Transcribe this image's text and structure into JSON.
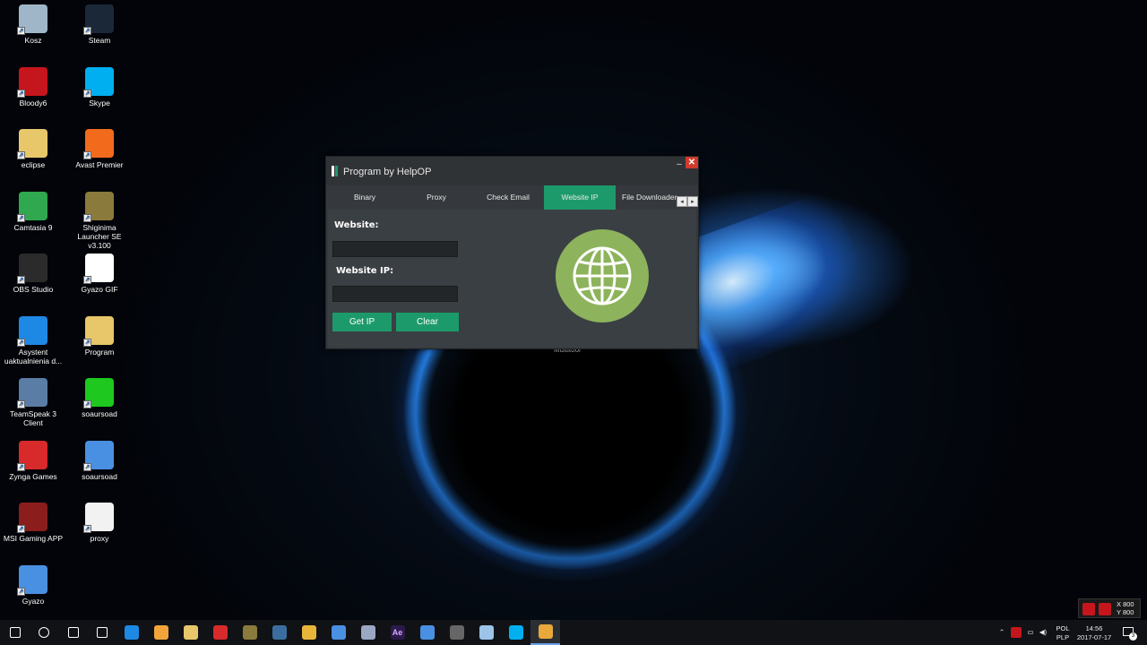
{
  "desktop": {
    "icons": [
      {
        "label": "Kosz",
        "icon": "recycle-bin-icon",
        "color": "#9fb6c9"
      },
      {
        "label": "Steam",
        "icon": "steam-icon",
        "color": "#1b2838"
      },
      {
        "label": "Bloody6",
        "icon": "bloody-hand-icon",
        "color": "#c4161c"
      },
      {
        "label": "Skype",
        "icon": "skype-icon",
        "color": "#00aff0"
      },
      {
        "label": "eclipse",
        "icon": "folder-icon",
        "color": "#e8c76a"
      },
      {
        "label": "Avast Premier",
        "icon": "avast-icon",
        "color": "#f26b1d"
      },
      {
        "label": "Camtasia 9",
        "icon": "camtasia-icon",
        "color": "#2fa84f"
      },
      {
        "label": "Shiginima Launcher SE v3.100",
        "icon": "minecraft-block-icon",
        "color": "#8a7a3c"
      },
      {
        "label": "OBS Studio",
        "icon": "obs-icon",
        "color": "#2b2b2b"
      },
      {
        "label": "Gyazo GIF",
        "icon": "gyazo-gif-icon",
        "color": "#ffffff"
      },
      {
        "label": "Asystent uaktualnienia d...",
        "icon": "windows-logo-icon",
        "color": "#1e88e5"
      },
      {
        "label": "Program",
        "icon": "folder-icon",
        "color": "#e8c76a"
      },
      {
        "label": "TeamSpeak 3 Client",
        "icon": "teamspeak-icon",
        "color": "#5a7da6"
      },
      {
        "label": "soaursoad",
        "icon": "green-image-icon",
        "color": "#1ec81e"
      },
      {
        "label": "Zynga Games",
        "icon": "zynga-icon",
        "color": "#d82a2a"
      },
      {
        "label": "soaursoad",
        "icon": "video-file-icon",
        "color": "#4a90e2"
      },
      {
        "label": "MSI Gaming APP",
        "icon": "msi-dragon-icon",
        "color": "#8b1d1d"
      },
      {
        "label": "proxy",
        "icon": "text-file-icon",
        "color": "#f2f2f2"
      },
      {
        "label": "Gyazo",
        "icon": "gyazo-icon",
        "color": "#4a90e2"
      }
    ],
    "behind_label": "Multitool"
  },
  "window": {
    "title": "Program by HelpOP",
    "minimize_glyph": "–",
    "close_glyph": "✕",
    "tabs": [
      "Binary",
      "Proxy",
      "Check Email",
      "Website IP",
      "File Downloader"
    ],
    "active_tab": "Website IP",
    "tab_scroll_left": "◂",
    "tab_scroll_right": "▸",
    "website_label": "Website:",
    "website_value": "",
    "website_ip_label": "Website IP:",
    "website_ip_value": "",
    "get_ip_button": "Get IP",
    "clear_button": "Clear",
    "accent": "#1d9a6b",
    "globe_color": "#8db35c"
  },
  "taskbar": {
    "items": [
      "start-windows-icon",
      "search-icon",
      "task-view-icon",
      "store-icon",
      "edge-icon",
      "video-player-icon",
      "file-explorer-icon",
      "zynga-icon",
      "minecraft-block-icon",
      "steam-icon",
      "chrome-icon",
      "gyazo-icon",
      "obs-pill-icon",
      "after-effects-icon",
      "gyazo-gif-icon",
      "obs-icon",
      "notepad-icon",
      "skype-icon",
      "helpop-program-icon"
    ],
    "ae_label": "Ae",
    "tray": {
      "language_top": "POL",
      "language_bottom": "PLP",
      "time": "14:56",
      "date": "2017-07-17",
      "notifications_count": "3"
    }
  },
  "overlay": {
    "x_readout": "X 800",
    "y_readout": "Y 800"
  }
}
